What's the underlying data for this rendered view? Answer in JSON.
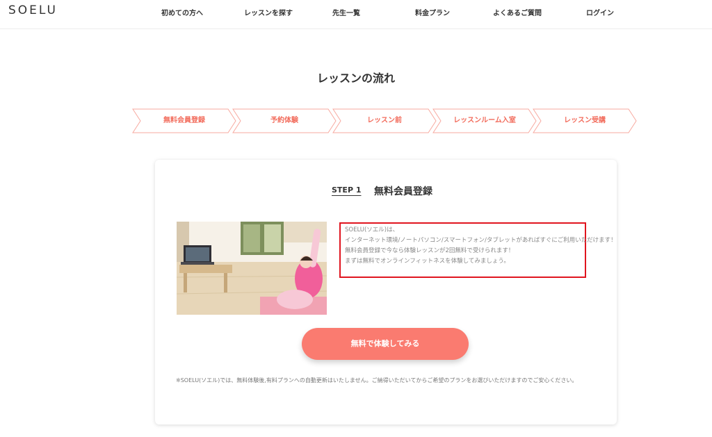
{
  "header": {
    "logo": "SOELU",
    "nav": [
      {
        "label": "初めての方へ"
      },
      {
        "label": "レッスンを探す"
      },
      {
        "label": "先生一覧"
      },
      {
        "label": "料金プラン"
      },
      {
        "label": "よくあるご質問"
      },
      {
        "label": "ログイン"
      }
    ]
  },
  "main": {
    "title": "レッスンの流れ",
    "steps": [
      {
        "label": "無料会員登録"
      },
      {
        "label": "予約体験"
      },
      {
        "label": "レッスン前"
      },
      {
        "label": "レッスンルーム入室"
      },
      {
        "label": "レッスン受講"
      }
    ],
    "card": {
      "step_label": "STEP 1",
      "step_title": "無料会員登録",
      "info_lines": [
        "SOELU(ソエル)は、",
        "インターネット環境/ノートパソコン/スマートフォン/タブレットがあればすぐにご利用いただけます！",
        "無料会員登録で今なら体験レッスンが2回無料で受けられます！",
        "まずは無料でオンラインフィットネスを体験してみましょう。"
      ],
      "cta_label": "無料で体験してみる",
      "note": "※SOELU(ソエル)では、無料体験後,有料プランへの自動更新はいたしません。ご納得いただいてからご希望のプランをお選びいただけますのでご安心ください。"
    }
  },
  "colors": {
    "accent": "#f26b5b",
    "cta": "#fa7b70",
    "highlight_border": "#e0141e"
  }
}
